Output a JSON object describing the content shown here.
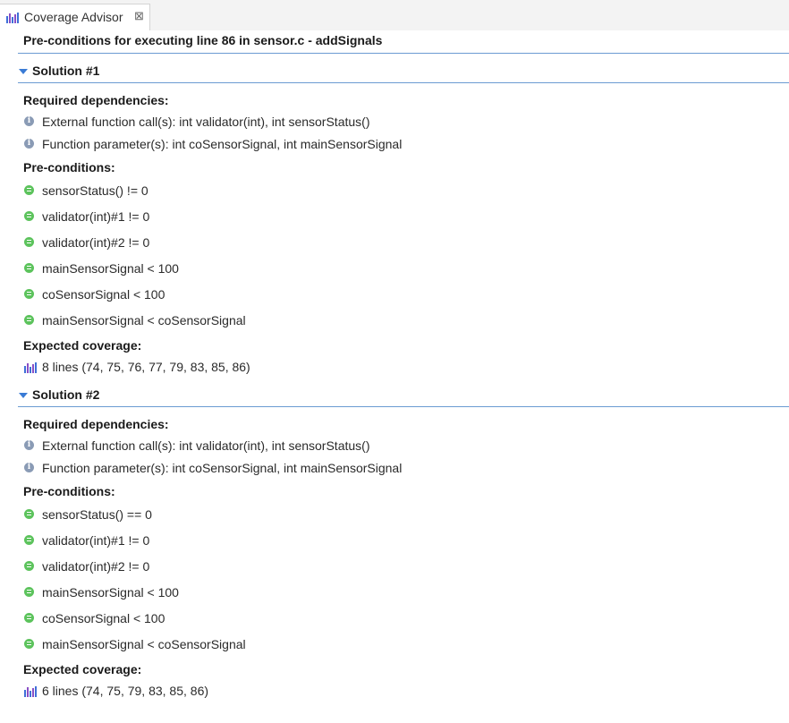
{
  "tab": {
    "title": "Coverage Advisor",
    "close_glyph": "⊠",
    "icon": "bar-chart-icon"
  },
  "header": {
    "title": "Pre-conditions for executing line 86 in sensor.c - addSignals"
  },
  "colors": {
    "accent_line": "#6b9bd2",
    "ok": "#5cc35c",
    "info": "#8a9bb5",
    "chart_blue": "#3f6fd8",
    "chart_purple": "#8a4fc6"
  },
  "solutions": [
    {
      "title": "Solution #1",
      "dependencies_label": "Required dependencies:",
      "dependencies": [
        "External function call(s): int validator(int), int sensorStatus()",
        "Function parameter(s): int coSensorSignal, int mainSensorSignal"
      ],
      "preconditions_label": "Pre-conditions:",
      "preconditions": [
        "sensorStatus() != 0",
        "validator(int)#1 != 0",
        "validator(int)#2 != 0",
        "mainSensorSignal < 100",
        "coSensorSignal < 100",
        "mainSensorSignal < coSensorSignal"
      ],
      "coverage_label": "Expected coverage:",
      "coverage": "8 lines (74, 75, 76, 77, 79, 83, 85, 86)"
    },
    {
      "title": "Solution #2",
      "dependencies_label": "Required dependencies:",
      "dependencies": [
        "External function call(s): int validator(int), int sensorStatus()",
        "Function parameter(s): int coSensorSignal, int mainSensorSignal"
      ],
      "preconditions_label": "Pre-conditions:",
      "preconditions": [
        "sensorStatus() == 0",
        "validator(int)#1 != 0",
        "validator(int)#2 != 0",
        "mainSensorSignal < 100",
        "coSensorSignal < 100",
        "mainSensorSignal < coSensorSignal"
      ],
      "coverage_label": "Expected coverage:",
      "coverage": "6 lines (74, 75, 79, 83, 85, 86)"
    }
  ]
}
